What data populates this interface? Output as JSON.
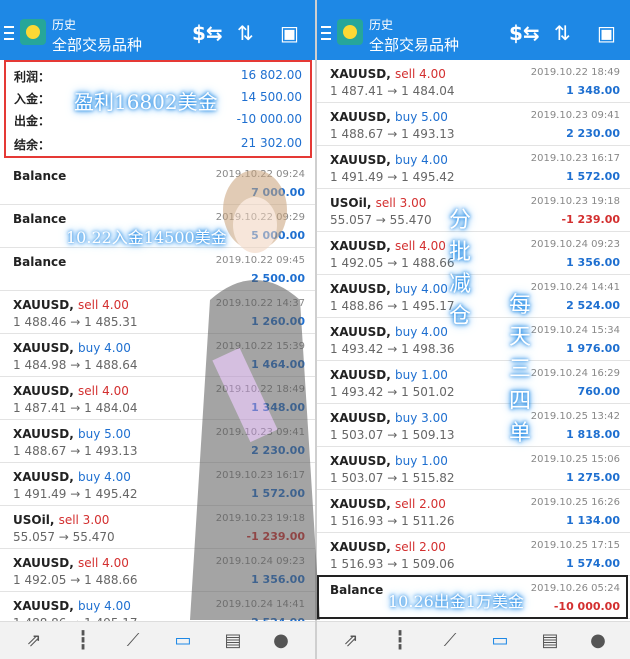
{
  "appbar": {
    "title_small": "历史",
    "title_big": "全部交易品种"
  },
  "summary": {
    "rows": [
      {
        "label": "利润：",
        "value": "16 802.00"
      },
      {
        "label": "入金：",
        "value": "14 500.00"
      },
      {
        "label": "出金：",
        "value": "-10 000.00"
      },
      {
        "label": "结余：",
        "value": "21 302.00"
      }
    ]
  },
  "left_list": [
    {
      "sym": "Balance",
      "side": "",
      "price": "",
      "dt": "2019.10.22 09:24",
      "pl": "7 000.00"
    },
    {
      "sym": "Balance",
      "side": "",
      "price": "",
      "dt": "2019.10.22 09:29",
      "pl": "5 000.00"
    },
    {
      "sym": "Balance",
      "side": "",
      "price": "",
      "dt": "2019.10.22 09:45",
      "pl": "2 500.00"
    },
    {
      "sym": "XAUUSD,",
      "side": "sell 4.00",
      "price": "1 488.46 → 1 485.31",
      "dt": "2019.10.22 14:37",
      "pl": "1 260.00"
    },
    {
      "sym": "XAUUSD,",
      "side": "buy 4.00",
      "price": "1 484.98 → 1 488.64",
      "dt": "2019.10.22 15:39",
      "pl": "1 464.00"
    },
    {
      "sym": "XAUUSD,",
      "side": "sell 4.00",
      "price": "1 487.41 → 1 484.04",
      "dt": "2019.10.22 18:49",
      "pl": "1 348.00"
    },
    {
      "sym": "XAUUSD,",
      "side": "buy 5.00",
      "price": "1 488.67 → 1 493.13",
      "dt": "2019.10.23 09:41",
      "pl": "2 230.00"
    },
    {
      "sym": "XAUUSD,",
      "side": "buy 4.00",
      "price": "1 491.49 → 1 495.42",
      "dt": "2019.10.23 16:17",
      "pl": "1 572.00"
    },
    {
      "sym": "USOil,",
      "side": "sell 3.00",
      "price": "55.057 → 55.470",
      "dt": "2019.10.23 19:18",
      "pl": "-1 239.00"
    },
    {
      "sym": "XAUUSD,",
      "side": "sell 4.00",
      "price": "1 492.05 → 1 488.66",
      "dt": "2019.10.24 09:23",
      "pl": "1 356.00"
    },
    {
      "sym": "XAUUSD,",
      "side": "buy 4.00",
      "price": "1 488.86 → 1 495.17",
      "dt": "2019.10.24 14:41",
      "pl": "2 524.00"
    }
  ],
  "right_list": [
    {
      "sym": "XAUUSD,",
      "side": "sell 4.00",
      "price": "1 487.41 → 1 484.04",
      "dt": "2019.10.22 18:49",
      "pl": "1 348.00"
    },
    {
      "sym": "XAUUSD,",
      "side": "buy 5.00",
      "price": "1 488.67 → 1 493.13",
      "dt": "2019.10.23 09:41",
      "pl": "2 230.00"
    },
    {
      "sym": "XAUUSD,",
      "side": "buy 4.00",
      "price": "1 491.49 → 1 495.42",
      "dt": "2019.10.23 16:17",
      "pl": "1 572.00"
    },
    {
      "sym": "USOil,",
      "side": "sell 3.00",
      "price": "55.057 → 55.470",
      "dt": "2019.10.23 19:18",
      "pl": "-1 239.00"
    },
    {
      "sym": "XAUUSD,",
      "side": "sell 4.00",
      "price": "1 492.05 → 1 488.66",
      "dt": "2019.10.24 09:23",
      "pl": "1 356.00"
    },
    {
      "sym": "XAUUSD,",
      "side": "buy 4.00",
      "price": "1 488.86 → 1 495.17",
      "dt": "2019.10.24 14:41",
      "pl": "2 524.00"
    },
    {
      "sym": "XAUUSD,",
      "side": "buy 4.00",
      "price": "1 493.42 → 1 498.36",
      "dt": "2019.10.24 15:34",
      "pl": "1 976.00"
    },
    {
      "sym": "XAUUSD,",
      "side": "buy 1.00",
      "price": "1 493.42 → 1 501.02",
      "dt": "2019.10.24 16:29",
      "pl": "760.00"
    },
    {
      "sym": "XAUUSD,",
      "side": "buy 3.00",
      "price": "1 503.07 → 1 509.13",
      "dt": "2019.10.25 13:42",
      "pl": "1 818.00"
    },
    {
      "sym": "XAUUSD,",
      "side": "buy 1.00",
      "price": "1 503.07 → 1 515.82",
      "dt": "2019.10.25 15:06",
      "pl": "1 275.00"
    },
    {
      "sym": "XAUUSD,",
      "side": "sell 2.00",
      "price": "1 516.93 → 1 511.26",
      "dt": "2019.10.25 16:26",
      "pl": "1 134.00"
    },
    {
      "sym": "XAUUSD,",
      "side": "sell 2.00",
      "price": "1 516.93 → 1 509.06",
      "dt": "2019.10.25 17:15",
      "pl": "1 574.00"
    },
    {
      "sym": "Balance",
      "side": "",
      "price": "",
      "dt": "2019.10.26 05:24",
      "pl": "-10 000.00"
    }
  ],
  "overlays": {
    "profit": "盈利16802美金",
    "deposit": "10.22入金14500美金",
    "reduce": "分批减仓",
    "daily": "每天三四单",
    "withdraw": "10.26出金1万美金"
  },
  "nav_icons": [
    "trade-icon",
    "candlestick-icon",
    "chart-icon",
    "history-icon",
    "news-icon",
    "chat-icon"
  ],
  "colors": {
    "accent": "#1e88e5",
    "profit": "#1e6fd0",
    "loss": "#d32f2f",
    "summary_border": "#e53935"
  }
}
